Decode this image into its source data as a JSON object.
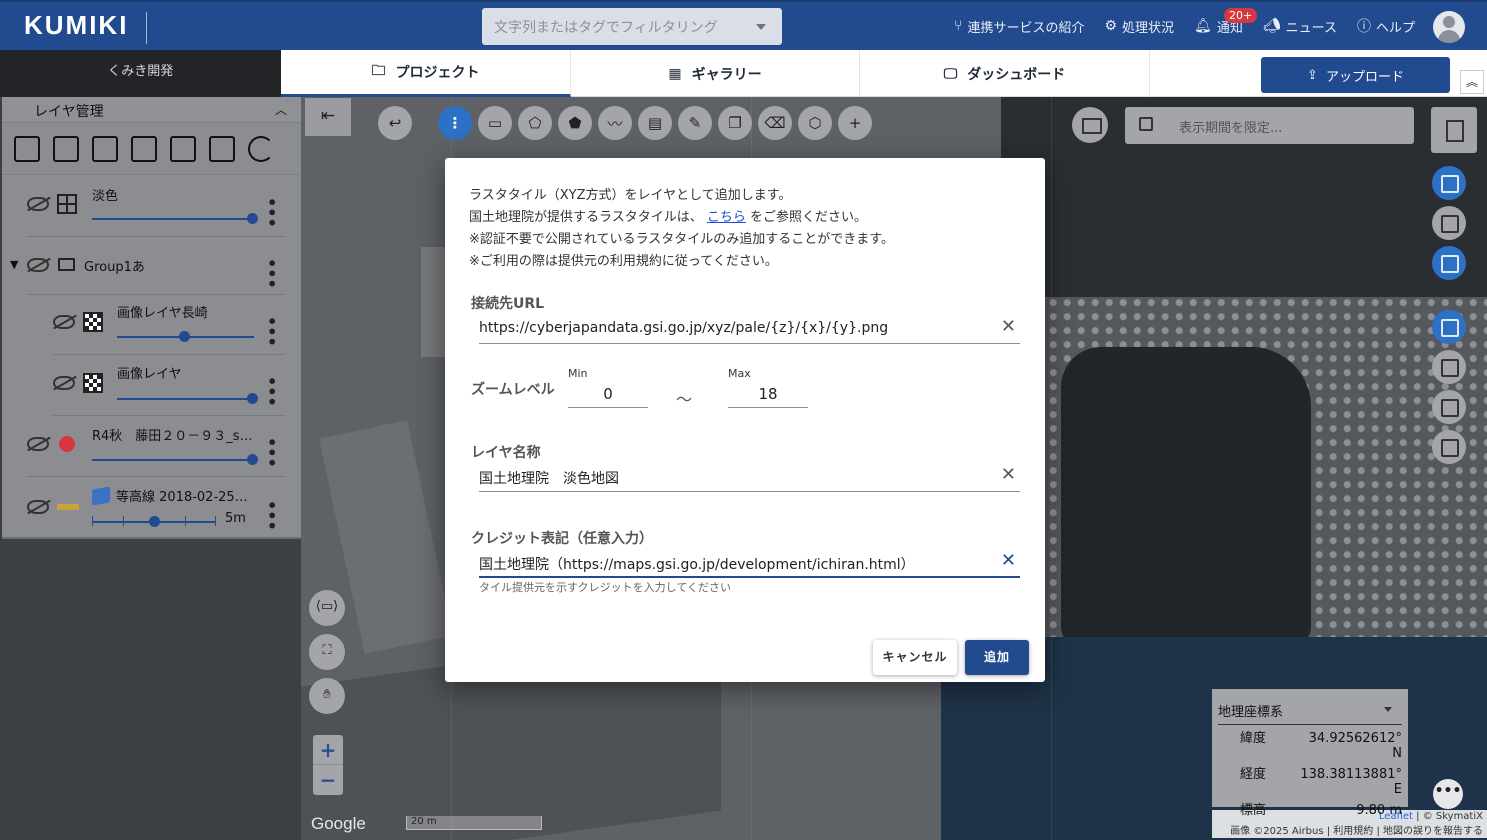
{
  "header": {
    "logo": "KUMIKI",
    "filter_placeholder": "文字列またはタグでフィルタリング",
    "nav": [
      {
        "label": "連携サービスの紹介",
        "icon": "share-icon"
      },
      {
        "label": "処理状況",
        "icon": "gear-icon"
      },
      {
        "label": "通知",
        "icon": "bell-icon"
      },
      {
        "label": "ニュース",
        "icon": "megaphone-icon"
      },
      {
        "label": "ヘルプ",
        "icon": "help-icon"
      }
    ],
    "notification_badge": "20+"
  },
  "workspace": "くみき開発",
  "tabs": [
    {
      "label": "プロジェクト",
      "icon": "folder-icon",
      "active": true
    },
    {
      "label": "ギャラリー",
      "icon": "grid-icon",
      "active": false
    },
    {
      "label": "ダッシュボード",
      "icon": "monitor-icon",
      "active": false
    }
  ],
  "upload_label": "アップロード",
  "layer_panel": {
    "title": "レイヤ管理",
    "layers": [
      {
        "name": "淡色",
        "type": "tile-grid",
        "opacity": 1.0
      },
      {
        "name": "Group1あ",
        "type": "group"
      },
      {
        "name": "画像レイヤ長崎",
        "type": "image",
        "opacity": 0.5
      },
      {
        "name": "画像レイヤ",
        "type": "image",
        "opacity": 1.0
      },
      {
        "name": "R4秋　藤田２０－９３_s…",
        "type": "point",
        "opacity": 1.0
      },
      {
        "name": "等高線 2018-02-25…",
        "type": "contour",
        "interval": "5m"
      }
    ]
  },
  "date_filter_placeholder": "表示期間を限定...",
  "map": {
    "scale": "20 m",
    "google": "Google",
    "attribution_leaflet": "Leaflet",
    "attribution_skymatix": "| © SkymatiX",
    "attribution_line2": "画像 ©2025 Airbus | 利用規約 | 地図の誤りを報告する"
  },
  "coordinates": {
    "system": "地理座標系",
    "lat_label": "緯度",
    "lat_value": "34.92562612° N",
    "lon_label": "経度",
    "lon_value": "138.38113881° E",
    "elev_label": "標高",
    "elev_value": "9.80 m"
  },
  "dialog": {
    "intro_line1": "ラスタタイル（XYZ方式）をレイヤとして追加します。",
    "intro_line2_pre": "国土地理院が提供するラスタタイルは、",
    "intro_link": "こちら",
    "intro_line2_post": "をご参照ください。",
    "intro_line3": "※認証不要で公開されているラスタタイルのみ追加することができます。",
    "intro_line4": "※ご利用の際は提供元の利用規約に従ってください。",
    "url_label": "接続先URL",
    "url_value": "https://cyberjapandata.gsi.go.jp/xyz/pale/{z}/{x}/{y}.png",
    "zoom_label": "ズームレベル",
    "min_caption": "Min",
    "min_value": "0",
    "tilde": "～",
    "max_caption": "Max",
    "max_value": "18",
    "name_label": "レイヤ名称",
    "name_value": "国土地理院　淡色地図",
    "credit_label": "クレジット表記（任意入力）",
    "credit_value": "国土地理院（https://maps.gsi.go.jp/development/ichiran.html）",
    "credit_hint": "タイル提供元を示すクレジットを入力してください",
    "cancel_label": "キャンセル",
    "add_label": "追加"
  }
}
